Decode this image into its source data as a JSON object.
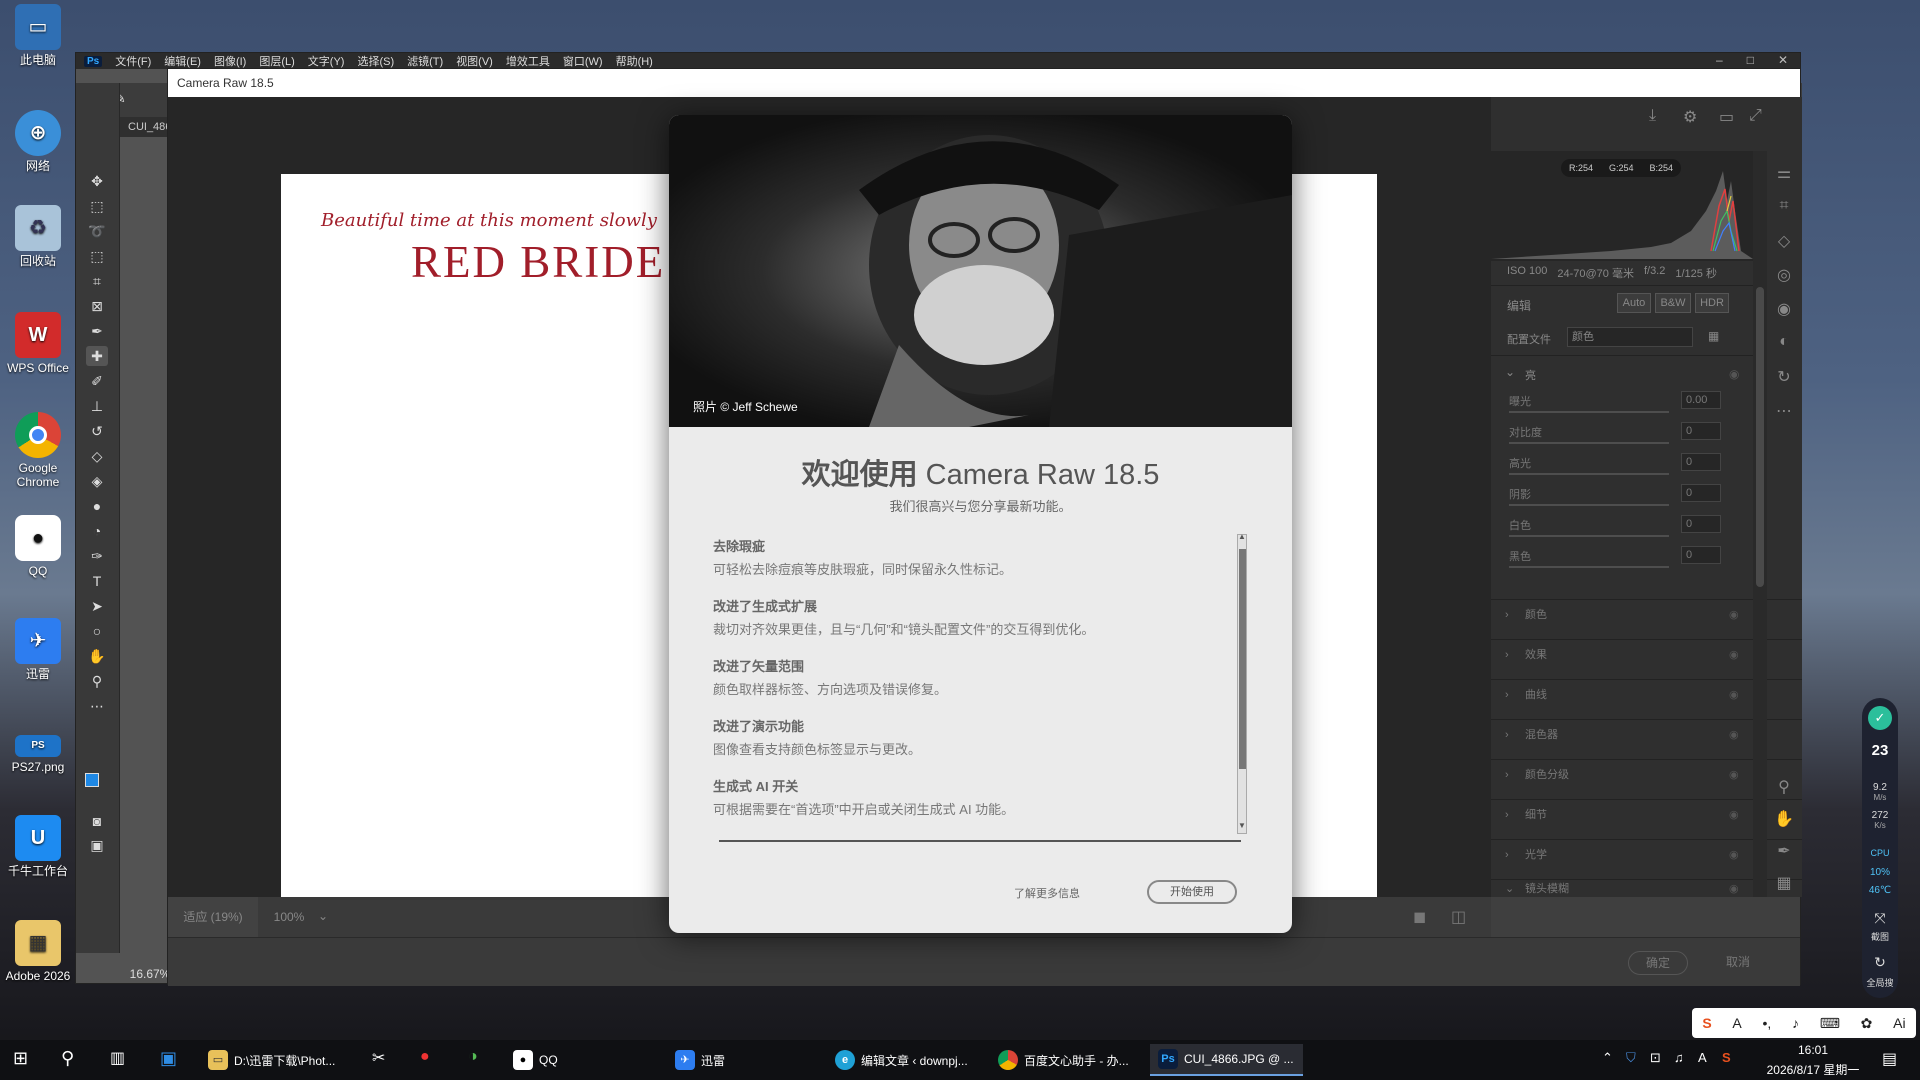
{
  "desktop": {
    "icons": [
      {
        "label": "此电脑"
      },
      {
        "label": "网络"
      },
      {
        "label": "回收站"
      },
      {
        "label": "WPS Office"
      },
      {
        "label": "Google Chrome"
      },
      {
        "label": "QQ"
      },
      {
        "label": "迅雷"
      },
      {
        "label": "PS27.png"
      },
      {
        "label": "千牛工作台"
      },
      {
        "label": "Adobe 2026"
      }
    ]
  },
  "photoshop": {
    "menus": [
      "文件(F)",
      "编辑(E)",
      "图像(I)",
      "图层(L)",
      "文字(Y)",
      "选择(S)",
      "滤镜(T)",
      "视图(V)",
      "增效工具",
      "窗口(W)",
      "帮助(H)"
    ],
    "doc_tab": "CUI_486",
    "zoom_pct": "16.67%"
  },
  "camera_raw": {
    "window_title": "Camera Raw 18.5",
    "image_text_line1": "Beautiful time at this moment slowly",
    "image_text_line2": "RED BRIDE",
    "fit_label": "适应 (19%)",
    "zoom_select": "100%",
    "rgb": {
      "r": "R:254",
      "g": "G:254",
      "b": "B:254"
    },
    "exif": {
      "iso": "ISO 100",
      "lens": "24-70@70 毫米",
      "aperture": "f/3.2",
      "shutter": "1/125 秒"
    },
    "edit_label": "编辑",
    "edit_buttons": [
      "Auto",
      "B&W",
      "HDR"
    ],
    "profile_label": "配置文件",
    "profile_value": "颜色",
    "light_section": "亮",
    "sliders": [
      {
        "label": "曝光",
        "value": "0.00"
      },
      {
        "label": "对比度",
        "value": "0"
      },
      {
        "label": "高光",
        "value": "0"
      },
      {
        "label": "阴影",
        "value": "0"
      },
      {
        "label": "白色",
        "value": "0"
      },
      {
        "label": "黑色",
        "value": "0"
      }
    ],
    "sections": [
      "颜色",
      "效果",
      "曲线",
      "混色器",
      "颜色分级",
      "细节",
      "光学",
      "镜头模糊"
    ],
    "ok_label": "确定",
    "cancel_label": "取消"
  },
  "dialog": {
    "photo_credit": "照片 © Jeff Schewe",
    "title_prefix": "欢迎使用",
    "title_product": "Camera Raw 18.5",
    "subtitle": "我们很高兴与您分享最新功能。",
    "features": [
      {
        "heading": "去除瑕疵",
        "desc": "可轻松去除痘痕等皮肤瑕疵，同时保留永久性标记。"
      },
      {
        "heading": "改进了生成式扩展",
        "desc": "裁切对齐效果更佳，且与“几何”和“镜头配置文件”的交互得到优化。"
      },
      {
        "heading": "改进了矢量范围",
        "desc": "颜色取样器标签、方向选项及错误修复。"
      },
      {
        "heading": "改进了演示功能",
        "desc": "图像查看支持颜色标签显示与更改。"
      },
      {
        "heading": "生成式 AI 开关",
        "desc": "可根据需要在“首选项”中开启或关闭生成式 AI 功能。"
      }
    ],
    "learn_more": "了解更多信息",
    "start_button": "开始使用"
  },
  "side_widget": {
    "count": "23",
    "up_speed": "9.2",
    "up_unit": "M/s",
    "down_speed": "272",
    "down_unit": "K/s",
    "cpu_label": "CPU",
    "cpu_pct": "10%",
    "cpu_temp": "46℃",
    "screenshot_label": "截图",
    "search_label": "全局搜"
  },
  "taskbar": {
    "apps": [
      {
        "label": "D:\\迅雷下载\\Phot..."
      },
      {
        "label": "QQ"
      },
      {
        "label": "迅雷"
      },
      {
        "label": "编辑文章 ‹ downpj..."
      },
      {
        "label": "百度文心助手 - 办..."
      },
      {
        "label": "CUI_4866.JPG @ ..."
      }
    ],
    "time": "16:01",
    "date": "2026/8/17 星期一"
  },
  "colors": {
    "ps_blue": "#31a8ff",
    "accent_red": "#a11e2a",
    "dialog_bg": "#ebebeb"
  }
}
